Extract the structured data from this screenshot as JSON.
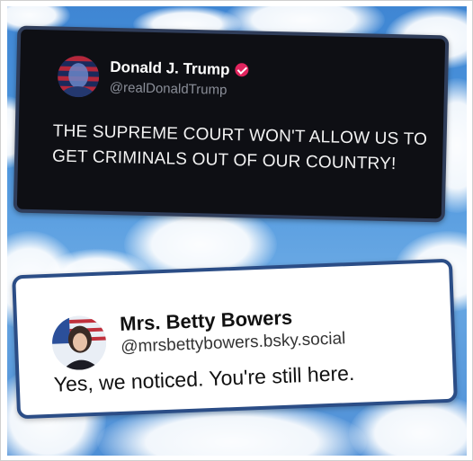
{
  "colors": {
    "dark_card_bg": "#0e0f14",
    "dark_card_border": "#2f3d5a",
    "light_card_border": "#2b4d86",
    "verified_badge": "#e0245e",
    "sky": "#4f97de"
  },
  "post_top": {
    "display_name": "Donald J. Trump",
    "handle": "@realDonaldTrump",
    "verified_icon": "verified-check-icon",
    "body": "THE SUPREME COURT WON'T ALLOW US TO GET CRIMINALS OUT OF OUR COUNTRY!"
  },
  "post_bottom": {
    "display_name": "Mrs. Betty Bowers",
    "handle": "@mrsbettybowers.bsky.social",
    "body": "Yes, we noticed. You're still here."
  }
}
